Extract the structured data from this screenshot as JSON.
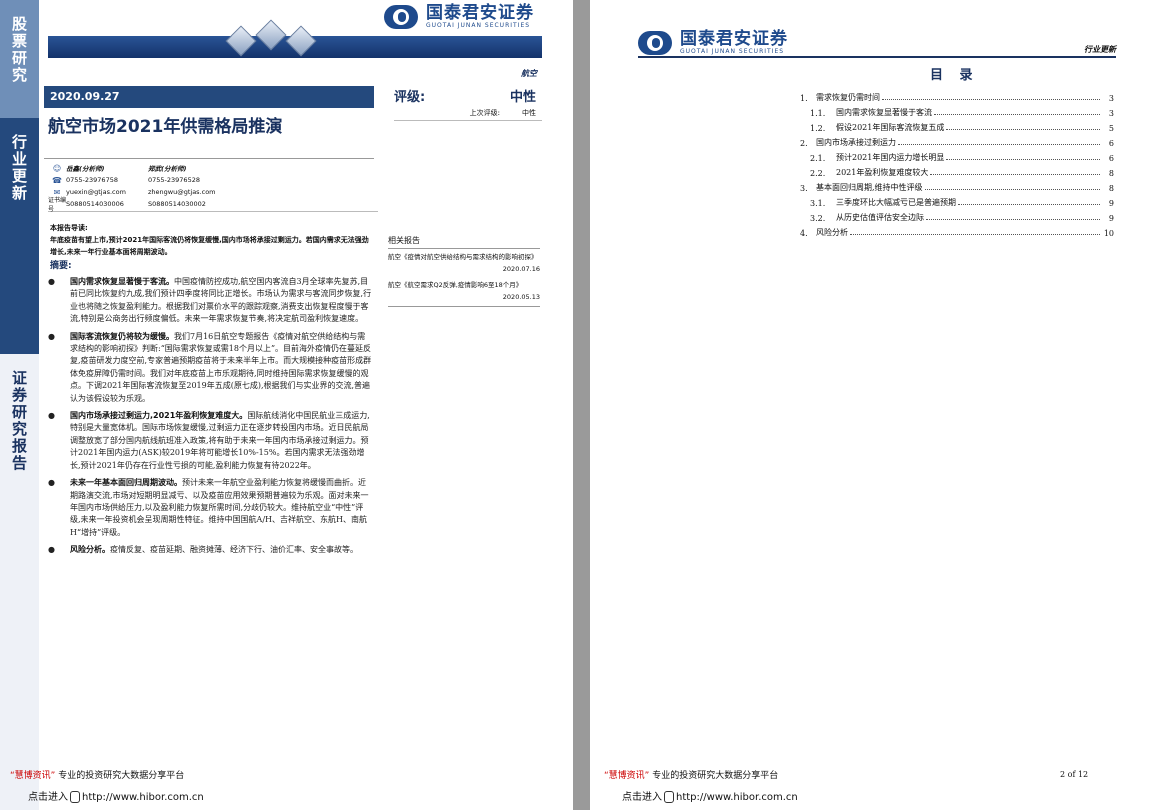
{
  "page1": {
    "sidebar": [
      "股票研究",
      "行业更新",
      "证券研究报告"
    ],
    "logo": {
      "cn": "国泰君安证券",
      "en": "GUOTAI JUNAN SECURITIES"
    },
    "industry": "航空",
    "date": "2020.09.27",
    "title": "航空市场2021年供需格局推演",
    "rating": {
      "label": "评级:",
      "value": "中性",
      "prev_label": "上次评级:",
      "prev_value": "中性"
    },
    "analysts": [
      {
        "name": "岳鑫(分析师)",
        "phone": "0755-23976758",
        "email": "yuexin@gtjas.com",
        "cert": "S0880514030006"
      },
      {
        "name": "郑武(分析师)",
        "phone": "0755-23976528",
        "email": "zhengwu@gtjas.com",
        "cert": "S0880514030002"
      }
    ],
    "cert_label": "证书编号",
    "guide": {
      "title": "本报告导读:",
      "text": "年底疫苗有望上市,预计2021年国际客流仍将恢复缓慢,国内市场将承接过剩运力。若国内需求无法强劲增长,未来一年行业基本面将周期波动。"
    },
    "abstract_title": "摘要:",
    "bullets": [
      {
        "bold": "国内需求恢复显著慢于客流。",
        "text": "中国疫情防控成功,航空国内客流自3月全球率先复苏,目前已同比恢复约九成,我们预计四季度将同比正增长。市场认为需求与客流同步恢复,行业也将随之恢复盈利能力。根据我们对票价水平的跟踪观察,消费支出恢复程度慢于客流,特别是公商务出行频度偏低。未来一年需求恢复节奏,将决定航司盈利恢复速度。"
      },
      {
        "bold": "国际客流恢复仍将较为缓慢。",
        "text": "我们7月16日航空专题报告《疫情对航空供给结构与需求结构的影响初探》判断:“国际需求恢复或需18个月以上”。目前海外疫情仍在蔓延反复,疫苗研发力度空前,专家普遍预期疫苗将于未来半年上市。而大规模接种疫苗形成群体免疫屏障仍需时间。我们对年底疫苗上市乐观期待,同时维持国际需求恢复缓慢的观点。下调2021年国际客流恢复至2019年五成(原七成),根据我们与实业界的交流,普遍认为该假设较为乐观。"
      },
      {
        "bold": "国内市场承接过剩运力,2021年盈利恢复难度大。",
        "text": "国际航线消化中国民航业三成运力,特别是大量宽体机。国际市场恢复缓慢,过剩运力正在逐步转投国内市场。近日民航局调整放宽了部分国内航线航班准入政策,将有助于未来一年国内市场承接过剩运力。预计2021年国内运力(ASK)较2019年将可能增长10%-15%。若国内需求无法强劲增长,预计2021年仍存在行业性亏损的可能,盈利能力恢复有待2022年。"
      },
      {
        "bold": "未来一年基本面回归周期波动。",
        "text": "预计未来一年航空业盈利能力恢复将缓慢而曲折。近期路演交流,市场对短期明显减亏、以及疫苗应用效果预期普遍较为乐观。面对未来一年国内市场供给压力,以及盈利能力恢复所需时间,分歧仍较大。维持航空业“中性”评级,未来一年投资机会呈现周期性特征。维持中国国航A/H、吉祥航空、东航H、南航H“增持”评级。"
      },
      {
        "bold": "风险分析。",
        "text": "疫情反复、疫苗延期、融资摊薄、经济下行、油价汇率、安全事故等。"
      }
    ],
    "related": {
      "title": "相关报告",
      "items": [
        {
          "text": "航空《疫情对航空供给结构与需求结构的影响初探》",
          "date": "2020.07.16"
        },
        {
          "text": "航空《航空需求Q2反弹,疫情影响6至18个月》",
          "date": "2020.05.13"
        }
      ]
    },
    "footer": {
      "brand": "“慧博资讯”",
      "text": "专业的投资研究大数据分享平台",
      "link_prefix": "点击进入",
      "url": "http://www.hibor.com.cn"
    }
  },
  "page2": {
    "logo": {
      "cn": "国泰君安证券",
      "en": "GUOTAI JUNAN SECURITIES"
    },
    "tag": "行业更新",
    "toc_title": "目 录",
    "toc": [
      {
        "num": "1.",
        "label": "需求恢复仍需时间",
        "page": "3",
        "sub": false
      },
      {
        "num": "1.1.",
        "label": "国内需求恢复显著慢于客流",
        "page": "3",
        "sub": true
      },
      {
        "num": "1.2.",
        "label": "假设2021年国际客流恢复五成",
        "page": "5",
        "sub": true
      },
      {
        "num": "2.",
        "label": "国内市场承接过剩运力",
        "page": "6",
        "sub": false
      },
      {
        "num": "2.1.",
        "label": "预计2021年国内运力增长明显",
        "page": "6",
        "sub": true
      },
      {
        "num": "2.2.",
        "label": "2021年盈利恢复难度较大",
        "page": "8",
        "sub": true
      },
      {
        "num": "3.",
        "label": "基本面回归周期,维持中性评级",
        "page": "8",
        "sub": false
      },
      {
        "num": "3.1.",
        "label": "三季度环比大幅减亏已是普遍预期",
        "page": "9",
        "sub": true
      },
      {
        "num": "3.2.",
        "label": "从历史估值评估安全边际",
        "page": "9",
        "sub": true
      },
      {
        "num": "4.",
        "label": "风险分析",
        "page": "10",
        "sub": false
      }
    ],
    "page_number": "2 of 12",
    "footer": {
      "brand": "“慧博资讯”",
      "text": "专业的投资研究大数据分享平台",
      "link_prefix": "点击进入",
      "url": "http://www.hibor.com.cn"
    }
  }
}
